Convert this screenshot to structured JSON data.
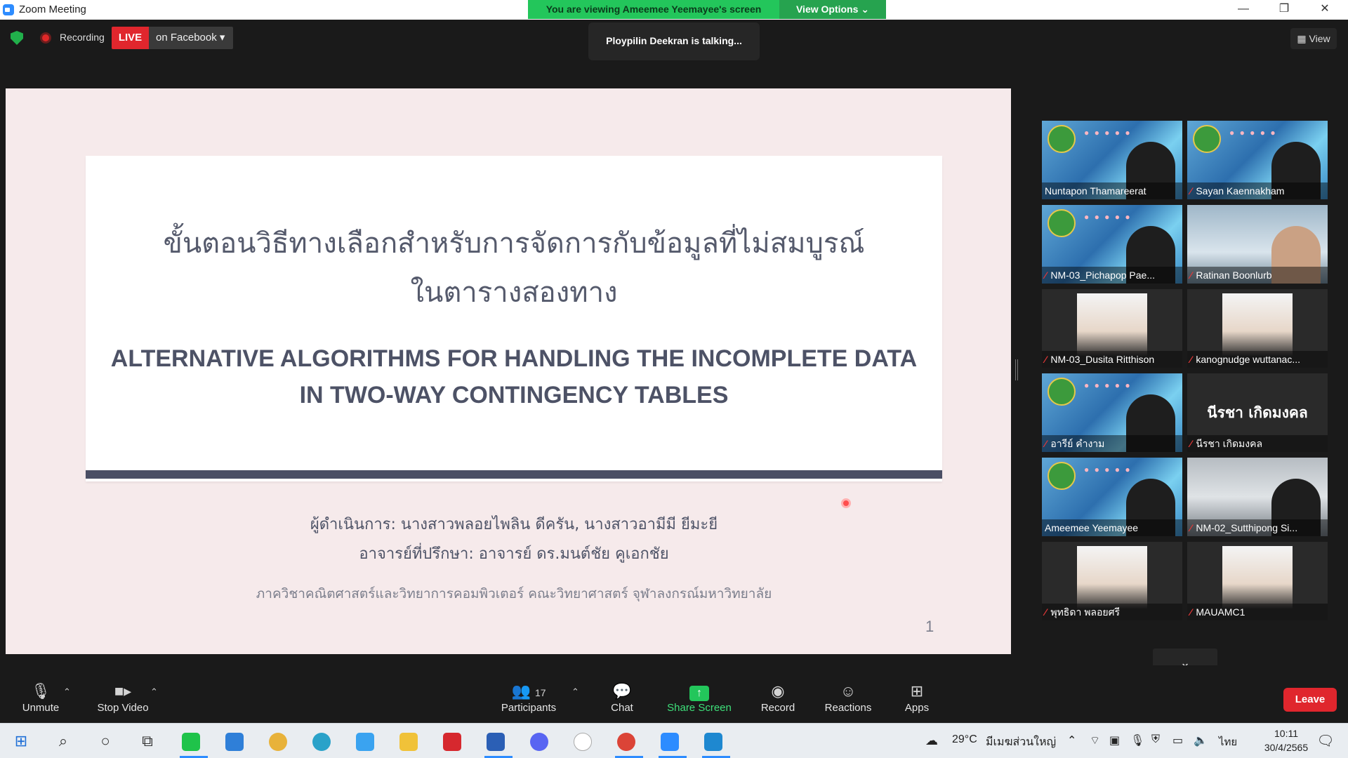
{
  "window": {
    "title": "Zoom Meeting",
    "minimize": "—",
    "restore": "❐",
    "close": "✕"
  },
  "share_banner": {
    "text": "You are viewing Ameemee Yeemayee's screen",
    "view_options": "View Options ⌄"
  },
  "top_bar": {
    "recording_label": "Recording",
    "live_label": "LIVE",
    "live_target": "on Facebook ▾",
    "talking": "Ploypilin Deekran is talking...",
    "view_label": "View"
  },
  "slide": {
    "title_th_line1": "ขั้นตอนวิธีทางเลือกสำหรับการจัดการกับข้อมูลที่ไม่สมบูรณ์",
    "title_th_line2": "ในตารางสองทาง",
    "title_en_line1": "ALTERNATIVE ALGORITHMS FOR HANDLING THE INCOMPLETE DATA",
    "title_en_line2": "IN TWO-WAY CONTINGENCY TABLES",
    "presenters": "ผู้ดำเนินการ: นางสาวพลอยไพลิน ดีครัน, นางสาวอามีมี ยีมะยี",
    "advisor": "อาจารย์ที่ปรึกษา: อาจารย์ ดร.มนต์ชัย คูเอกชัย",
    "department": "ภาควิชาคณิตศาสตร์และวิทยาการคอมพิวเตอร์ คณะวิทยาศาสตร์ จุฬาลงกรณ์มหาวิทยาลัย",
    "page_number": "1"
  },
  "participants": [
    {
      "name": "Nuntapon Thamareerat",
      "muted": false,
      "bg": "event",
      "avatar": "person-dark"
    },
    {
      "name": "Sayan Kaennakham",
      "muted": true,
      "bg": "event",
      "avatar": "person-dark"
    },
    {
      "name": "NM-03_Pichapop Pae...",
      "muted": true,
      "bg": "event",
      "avatar": "person-dark"
    },
    {
      "name": "Ratinan Boonlurb",
      "muted": true,
      "bg": "room",
      "avatar": "person-face"
    },
    {
      "name": "NM-03_Dusita Ritthison",
      "muted": true,
      "bg": "dark",
      "avatar": "photo"
    },
    {
      "name": "kanognudge wuttanac...",
      "muted": true,
      "bg": "dark",
      "avatar": "photo"
    },
    {
      "name": "อารีย์ คำงาม",
      "muted": true,
      "bg": "event",
      "avatar": "person-dark"
    },
    {
      "name": "นีรชา เกิดมงคล",
      "muted": true,
      "bg": "dark",
      "avatar": "none",
      "big_name": "นีรชา เกิดมงคล"
    },
    {
      "name": "Ameemee Yeemayee",
      "muted": false,
      "bg": "event",
      "avatar": "person-dark"
    },
    {
      "name": "NM-02_Sutthipong Si...",
      "muted": true,
      "bg": "blur",
      "avatar": "person-dark"
    },
    {
      "name": "พุทธิดา พลอยศรี",
      "muted": true,
      "bg": "dark",
      "avatar": "photo"
    },
    {
      "name": "MAUAMC1",
      "muted": true,
      "bg": "dark",
      "avatar": "photo"
    }
  ],
  "gallery_more": "⌄",
  "toolbar": {
    "unmute": "Unmute",
    "stop_video": "Stop Video",
    "participants": "Participants",
    "participant_count": "17",
    "chat": "Chat",
    "share_screen": "Share Screen",
    "record": "Record",
    "reactions": "Reactions",
    "apps": "Apps",
    "leave": "Leave",
    "caret": "⌃"
  },
  "taskbar": {
    "weather": "29°C",
    "location": "มีเมฆส่วนใหญ่",
    "language": "ไทย",
    "time": "10:11",
    "date": "30/4/2565"
  }
}
